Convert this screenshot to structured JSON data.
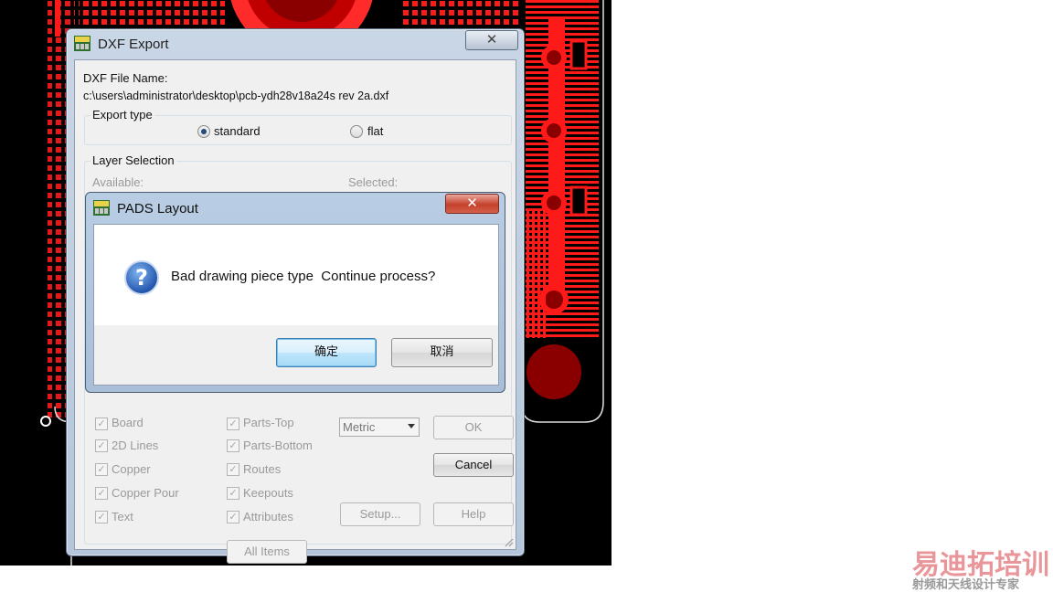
{
  "dxf_dialog": {
    "title": "DXF Export",
    "file_name_label": "DXF File Name:",
    "file_path": "c:\\users\\administrator\\desktop\\pcb-ydh28v18a24s rev 2a.dxf",
    "export_type": {
      "label": "Export type",
      "options": [
        {
          "label": "standard",
          "selected": true
        },
        {
          "label": "flat",
          "selected": false
        }
      ]
    },
    "layer_selection": {
      "label": "Layer Selection",
      "available_label": "Available:",
      "selected_label": "Selected:"
    },
    "items": {
      "left": [
        "Board",
        "2D Lines",
        "Copper",
        "Copper Pour",
        "Text"
      ],
      "right": [
        "Parts-Top",
        "Parts-Bottom",
        "Routes",
        "Keepouts",
        "Attributes"
      ],
      "all_items_button": "All  Items"
    },
    "units_select": "Metric",
    "ok_button": "OK",
    "cancel_button": "Cancel",
    "setup_button": "Setup...",
    "help_button": "Help",
    "close_glyph": "✕"
  },
  "message_box": {
    "title": "PADS Layout",
    "message": "Bad drawing piece type  Continue process?",
    "ok_button": "确定",
    "cancel_button": "取消",
    "close_glyph": "✕",
    "icon": "question-icon"
  },
  "watermark": {
    "line1": "易迪拓培训",
    "line2": "射频和天线设计专家"
  },
  "colors": {
    "pcb_background": "#000000",
    "copper": "#ff1a1a",
    "pad_dark": "#8a0000",
    "dialog_face": "#f0f0f0",
    "close_button_red": "#c4402b"
  }
}
